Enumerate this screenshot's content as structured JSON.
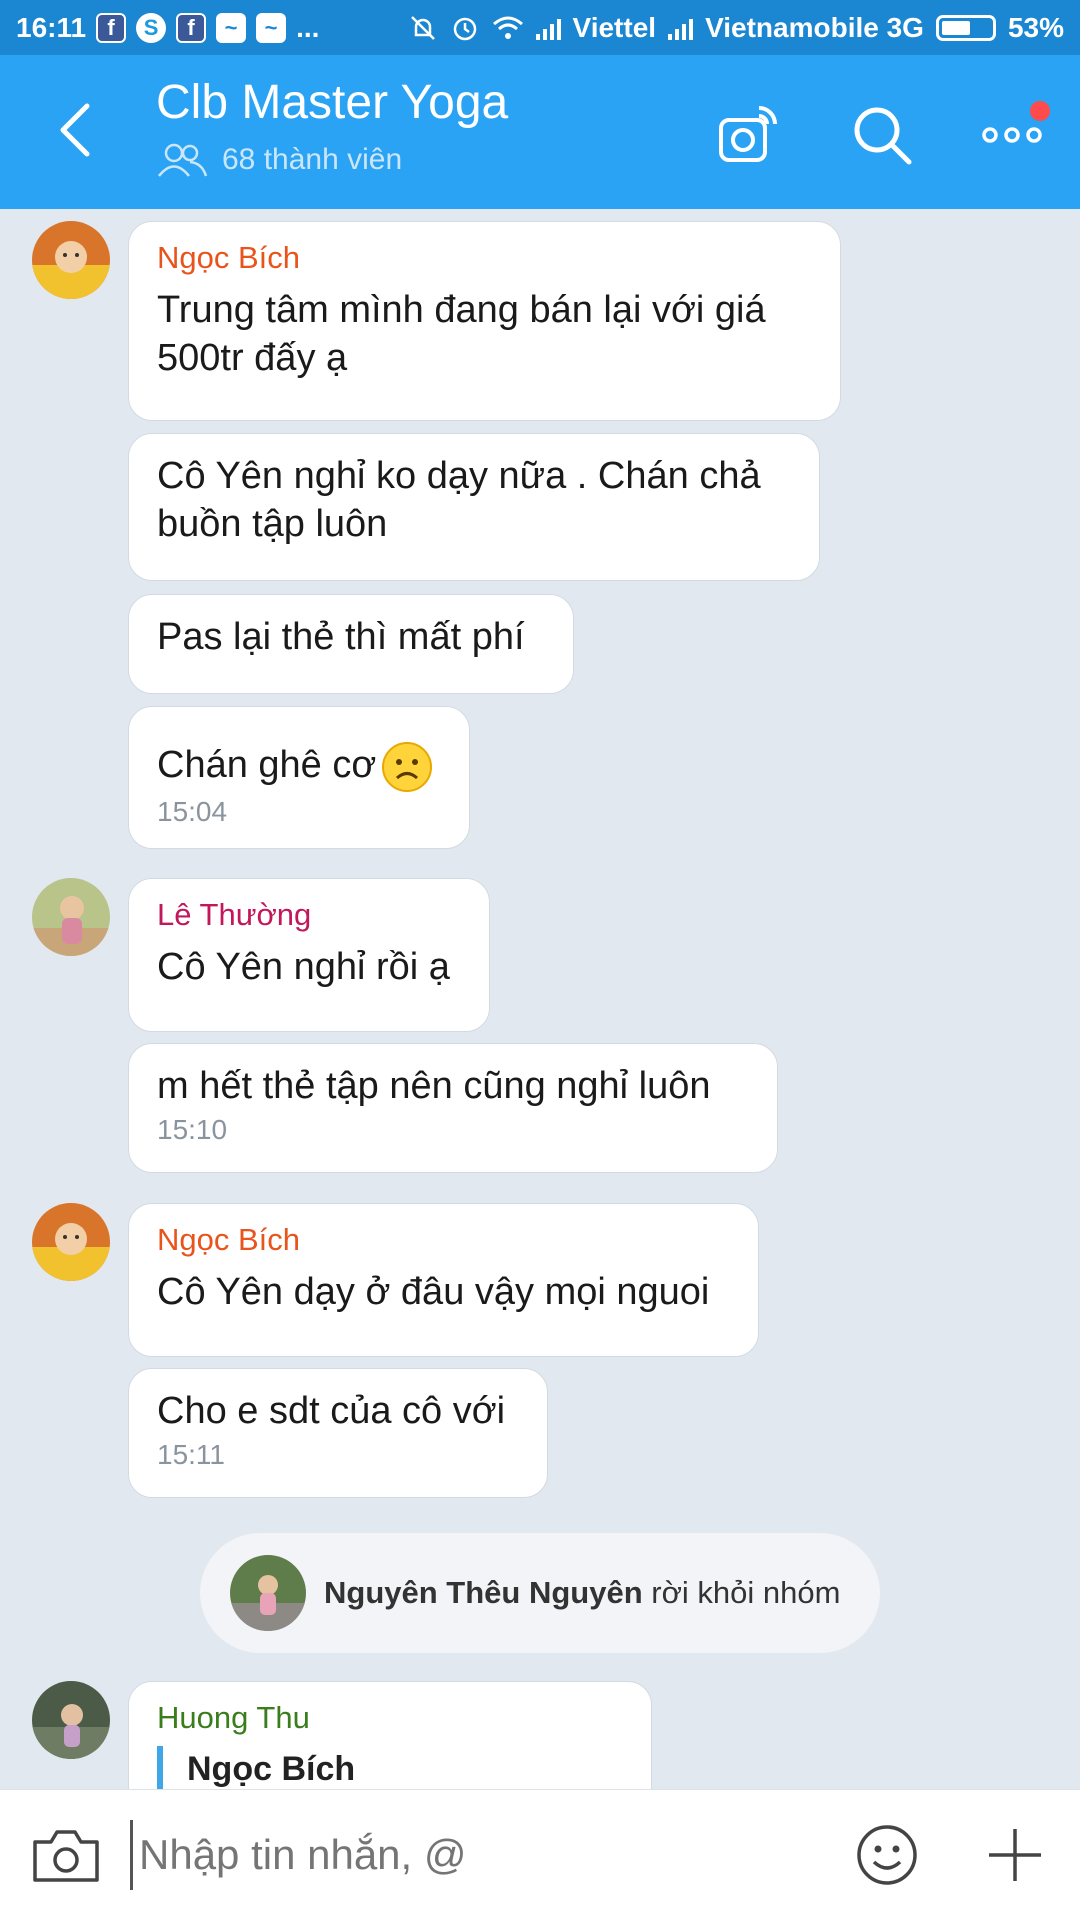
{
  "status_bar": {
    "time": "16:11",
    "carrier1": "Viettel",
    "carrier2": "Vietnamobile 3G",
    "battery": "53%",
    "ellipsis": "..."
  },
  "header": {
    "title": "Clb Master Yoga",
    "members": "68 thành viên",
    "accent": "#2aa3f5",
    "notification_dot_color": "#ff4b4b"
  },
  "messages": [
    {
      "sender": "Ngọc Bích",
      "sender_color": "#e8541c",
      "bubbles": [
        {
          "lines": [
            "Trung tâm mình đang bán lại với giá",
            "500tr đấy ạ"
          ]
        },
        {
          "lines": [
            "Cô Yên nghỉ ko dạy nữa . Chán chả",
            "buồn tập luôn"
          ]
        },
        {
          "lines": [
            "Pas lại thẻ thì mất phí"
          ]
        },
        {
          "lines": [
            "Chán ghê cơ"
          ],
          "emoji": "sad-face-emoji",
          "time": "15:04"
        }
      ]
    },
    {
      "sender": "Lê Thường",
      "sender_color": "#c2185b",
      "bubbles": [
        {
          "lines": [
            "Cô Yên nghỉ rồi ạ"
          ]
        },
        {
          "lines": [
            "m hết thẻ tập nên cũng nghỉ luôn"
          ],
          "time": "15:10"
        }
      ]
    },
    {
      "sender": "Ngọc Bích",
      "sender_color": "#e8541c",
      "bubbles": [
        {
          "lines": [
            "Cô Yên dạy ở đâu vậy mọi nguoi"
          ]
        },
        {
          "lines": [
            "Cho e sdt của cô với"
          ],
          "time": "15:11"
        }
      ]
    }
  ],
  "system_message": {
    "name": "Nguyên Thêu Nguyên",
    "action": " rời khỏi nhóm"
  },
  "last_message": {
    "sender": "Huong Thu",
    "sender_color": "#3a7d1c",
    "quote_name": "Ngọc Bích"
  },
  "input_bar": {
    "placeholder": "Nhập tin nhắn, @"
  }
}
